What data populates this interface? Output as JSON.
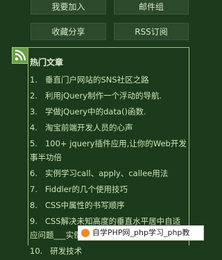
{
  "buttons": {
    "join": "我要加入",
    "mail": "邮件组",
    "fav": "收藏分享",
    "rss": "RSS订阅"
  },
  "panel": {
    "title": "热门文章",
    "items": [
      {
        "num": "1.",
        "text": "垂直门户网站的SNS社区之路"
      },
      {
        "num": "2.",
        "text": "利用jQuery制作一个浮动的导航."
      },
      {
        "num": "3.",
        "text": "学做jQuery中的data()函数."
      },
      {
        "num": "4.",
        "text": "淘宝前端开发人员的心声"
      },
      {
        "num": "5.",
        "text": "100+ jquery插件应用,让你的Web开发事半功倍"
      },
      {
        "num": "6.",
        "text": "实例学习call、apply、callee用法"
      },
      {
        "num": "7.",
        "text": "Fiddler的几个使用技巧"
      },
      {
        "num": "8.",
        "text": "CSS中属性的书写顺序"
      },
      {
        "num": "9.",
        "text": "CSS解决未知高度的垂直水平居中自适应问题___实例代码"
      },
      {
        "num": "10.",
        "text": "研发技术"
      }
    ]
  },
  "watermark": {
    "text": "自学PHP网_php学习_php教"
  },
  "colors": {
    "background": "#1c3a1c",
    "panel_border": "#9cc27d",
    "rss_green": "#7fb35a"
  }
}
